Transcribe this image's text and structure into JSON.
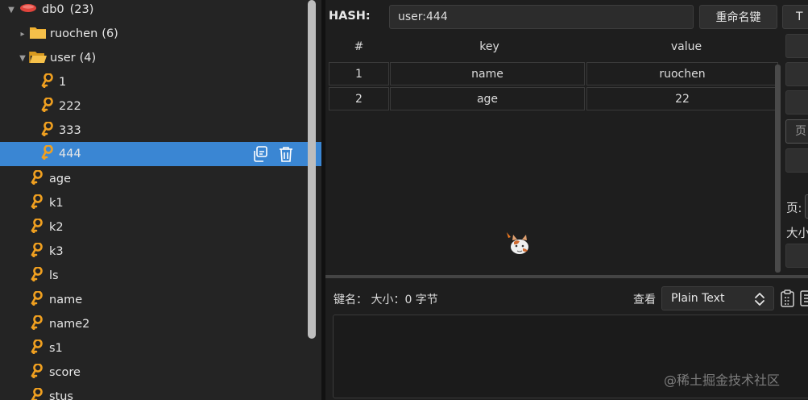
{
  "tree": {
    "db": {
      "name": "db0",
      "count": "(23)"
    },
    "folders": [
      {
        "name": "ruochen",
        "count": "(6)",
        "expanded": false
      },
      {
        "name": "user",
        "count": "(4)",
        "expanded": true
      }
    ],
    "user_keys": [
      "1",
      "222",
      "333",
      "444"
    ],
    "selected_key": "444",
    "root_keys": [
      "age",
      "k1",
      "k2",
      "k3",
      "ls",
      "name",
      "name2",
      "s1",
      "score",
      "stus"
    ]
  },
  "detail": {
    "type_label": "HASH:",
    "key_value": "user:444",
    "rename_label": "重命名键",
    "ttl_label": "T",
    "columns": [
      "#",
      "key",
      "value"
    ],
    "rows": [
      {
        "index": "1",
        "key": "name",
        "value": "ruochen"
      },
      {
        "index": "2",
        "key": "age",
        "value": "22"
      }
    ],
    "side_page_label": "页",
    "page_label": "页:",
    "size_label": "大小"
  },
  "viewer": {
    "key_name_label": "键名：",
    "size_label": "大小：0 字节",
    "view_label": "查看",
    "format_selected": "Plain Text"
  },
  "watermark": "@稀土掘金技术社区",
  "colors": {
    "selected": "#3a86d3",
    "key_icon": "#f0a020",
    "db_icon": "#e0443c",
    "folder": "#f0b030"
  }
}
